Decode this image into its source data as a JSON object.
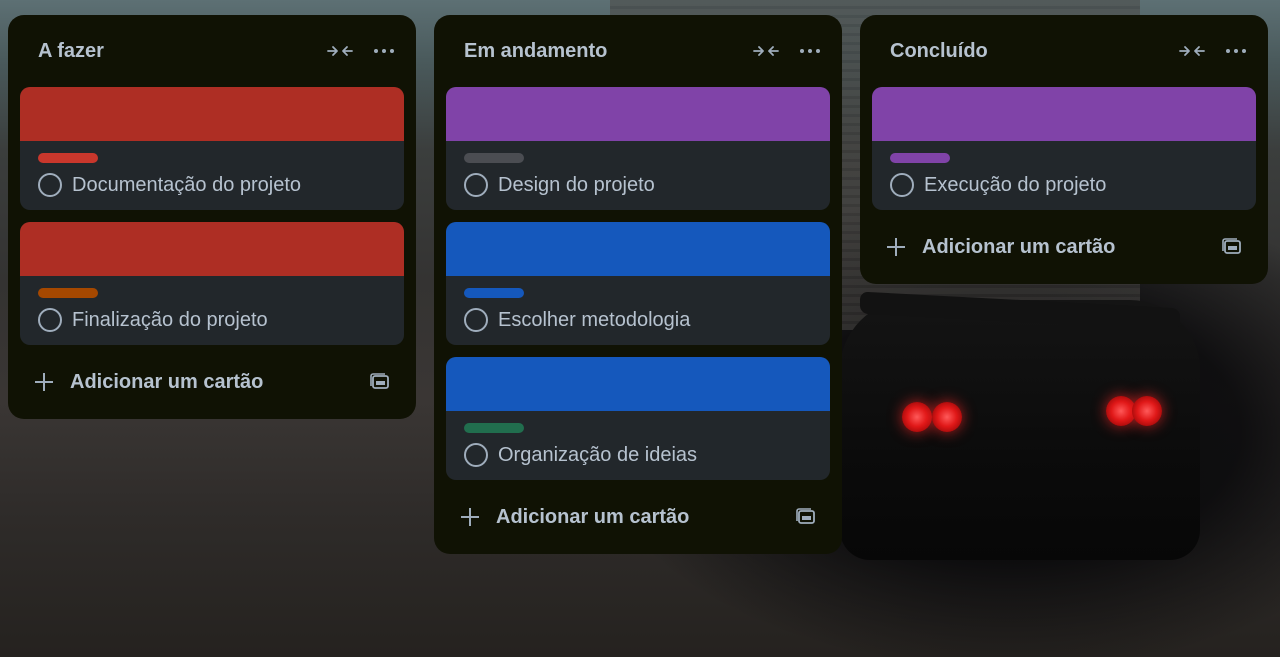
{
  "colors": {
    "column_bg": "#101204",
    "card_bg": "#22272b",
    "text": "#b6c2cf",
    "icon": "#9fadbc",
    "red": "#ae2e24",
    "purple": "#8043a8",
    "blue": "#1558bc",
    "orange": "#a54800",
    "gray": "#4b4d52",
    "green": "#216e4e",
    "label_red": "#c9372c"
  },
  "columns": [
    {
      "title": "A fazer",
      "collapse_icon": "collapse-arrows-icon",
      "menu_icon": "more-horizontal-icon",
      "cards": [
        {
          "title": "Documentação do projeto",
          "cover": "#ae2e24",
          "label": "#c9372c"
        },
        {
          "title": "Finalização do projeto",
          "cover": "#ae2e24",
          "label": "#a54800"
        }
      ],
      "add_label": "Adicionar um cartão",
      "template_icon": "card-template-icon"
    },
    {
      "title": "Em andamento",
      "collapse_icon": "collapse-arrows-icon",
      "menu_icon": "more-horizontal-icon",
      "cards": [
        {
          "title": "Design do projeto",
          "cover": "#8043a8",
          "label": "#4b4d52"
        },
        {
          "title": "Escolher metodologia",
          "cover": "#1558bc",
          "label": "#1558bc"
        },
        {
          "title": "Organização de ideias",
          "cover": "#1558bc",
          "label": "#216e4e"
        }
      ],
      "add_label": "Adicionar um cartão",
      "template_icon": "card-template-icon"
    },
    {
      "title": "Concluído",
      "collapse_icon": "collapse-arrows-icon",
      "menu_icon": "more-horizontal-icon",
      "cards": [
        {
          "title": "Execução do projeto",
          "cover": "#8043a8",
          "label": "#8043a8"
        }
      ],
      "add_label": "Adicionar um cartão",
      "template_icon": "card-template-icon"
    }
  ]
}
